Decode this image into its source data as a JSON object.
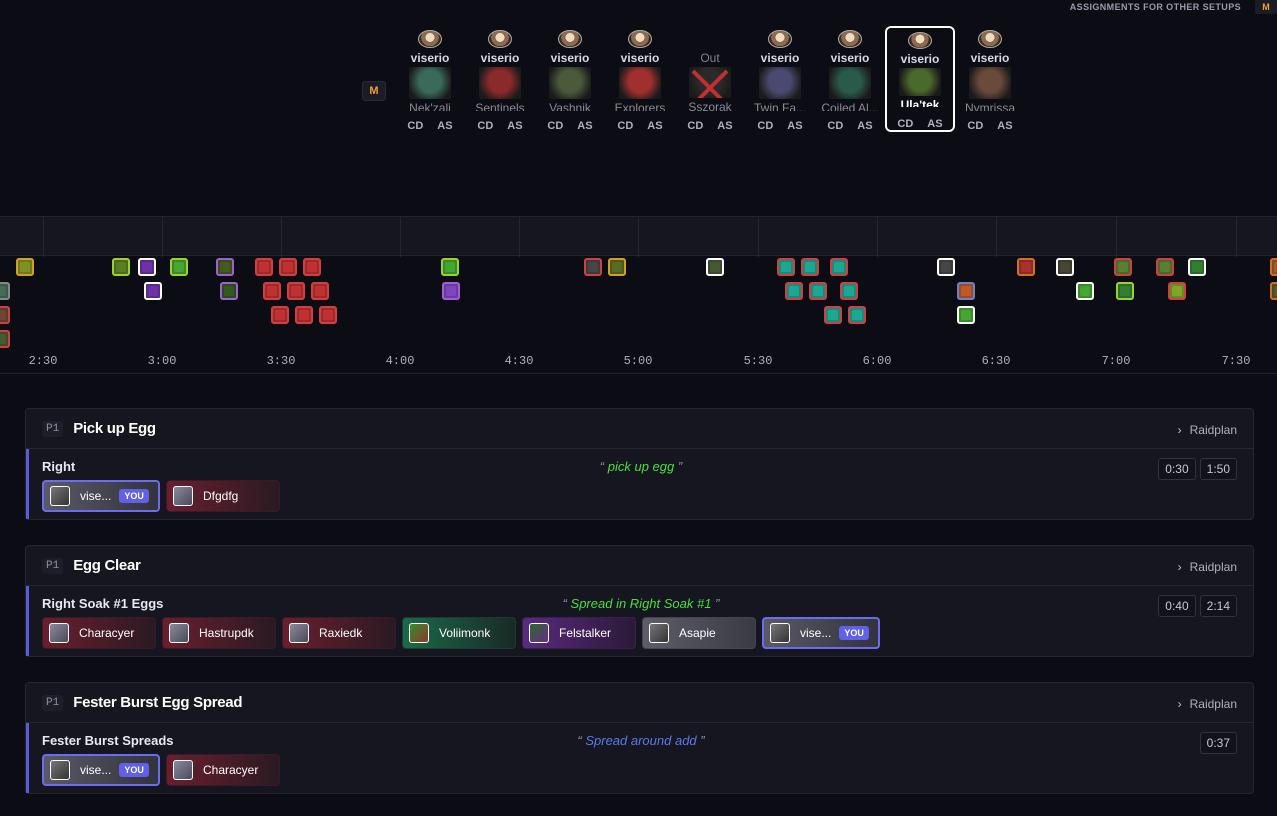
{
  "top": {
    "other_setups_label": "ASSIGNMENTS FOR OTHER SETUPS",
    "m_label": "M"
  },
  "difficulty_badge": "M",
  "bosses": [
    {
      "player": "viserio",
      "name": "Nek'zali",
      "cd": "CD",
      "as": "AS",
      "color": "#3a6a5a"
    },
    {
      "player": "viserio",
      "name": "Sentinels",
      "cd": "CD",
      "as": "AS",
      "color": "#8a2a2a"
    },
    {
      "player": "viserio",
      "name": "Vashnik",
      "cd": "CD",
      "as": "AS",
      "color": "#4a5a3a"
    },
    {
      "player": "viserio",
      "name": "Explorers",
      "cd": "CD",
      "as": "AS",
      "color": "#a03030"
    },
    {
      "player": "Out",
      "name": "Sszorak",
      "cd": "CD",
      "as": "AS",
      "color": "#2a2a2a",
      "out": true
    },
    {
      "player": "viserio",
      "name": "Twin Fa...",
      "cd": "CD",
      "as": "AS",
      "color": "#4a4a70"
    },
    {
      "player": "viserio",
      "name": "Coiled Al...",
      "cd": "CD",
      "as": "AS",
      "color": "#2a5a4a"
    },
    {
      "player": "viserio",
      "name": "Ula'tek",
      "cd": "CD",
      "as": "AS",
      "color": "#4a6a2a",
      "selected": true
    },
    {
      "player": "viserio",
      "name": "Nymrissa",
      "cd": "CD",
      "as": "AS",
      "color": "#6a4a3a"
    }
  ],
  "timeline": {
    "ticks": [
      "2:30",
      "3:00",
      "3:30",
      "4:00",
      "4:30",
      "5:00",
      "5:30",
      "6:00",
      "6:30",
      "7:00",
      "7:30"
    ]
  },
  "cards": [
    {
      "phase": "P1",
      "title": "Pick up Egg",
      "raidplan": "Raidplan",
      "row_label": "Right",
      "note": "pick up egg",
      "note_color": "#4ade40",
      "times": [
        "0:30",
        "1:50"
      ],
      "chips": [
        {
          "name": "vise...",
          "you": "YOU",
          "style": "you"
        },
        {
          "name": "Dfgdfg",
          "style": "red"
        }
      ]
    },
    {
      "phase": "P1",
      "title": "Egg Clear",
      "raidplan": "Raidplan",
      "row_label": "Right Soak #1 Eggs",
      "note": "Spread in Right Soak #1",
      "note_color": "#4ade40",
      "times": [
        "0:40",
        "2:14"
      ],
      "chips": [
        {
          "name": "Characyer",
          "style": "red"
        },
        {
          "name": "Hastrupdk",
          "style": "red"
        },
        {
          "name": "Raxiedk",
          "style": "red"
        },
        {
          "name": "Voliimonk",
          "style": "green"
        },
        {
          "name": "Felstalker",
          "style": "purple"
        },
        {
          "name": "Asapie",
          "style": "gray"
        },
        {
          "name": "vise...",
          "you": "YOU",
          "style": "you"
        }
      ]
    },
    {
      "phase": "P1",
      "title": "Fester Burst Egg Spread",
      "raidplan": "Raidplan",
      "row_label": "Fester Burst Spreads",
      "note": "Spread around add",
      "note_color": "#5a7ae8",
      "times": [
        "0:37"
      ],
      "chips": [
        {
          "name": "vise...",
          "you": "YOU",
          "style": "you"
        },
        {
          "name": "Characyer",
          "style": "red"
        }
      ]
    }
  ]
}
